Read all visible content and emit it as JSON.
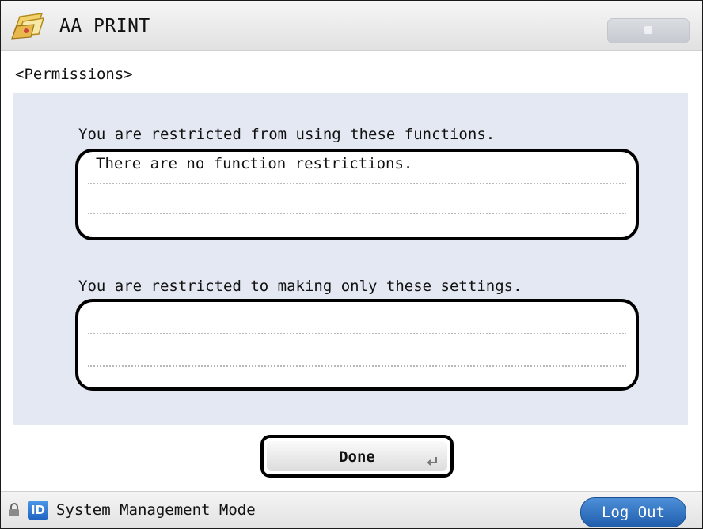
{
  "header": {
    "title": "AA PRINT",
    "icon": "aa-print-app-icon",
    "top_right_button_icon": "blank-button"
  },
  "section_title": "<Permissions>",
  "restricted_functions": {
    "label": "You are restricted from using these functions.",
    "message": "There are no function restrictions."
  },
  "restricted_settings": {
    "label": "You are restricted to making only these settings.",
    "message": ""
  },
  "done_button": {
    "label": "Done"
  },
  "status_bar": {
    "lock_icon": "lock-icon",
    "id_icon_text": "ID",
    "mode_label": "System Management Mode",
    "logout_label": "Log Out"
  },
  "colors": {
    "panel_background": "#e4e8f2",
    "logout_button": "#2f72c4",
    "id_badge": "#2a73d0"
  }
}
